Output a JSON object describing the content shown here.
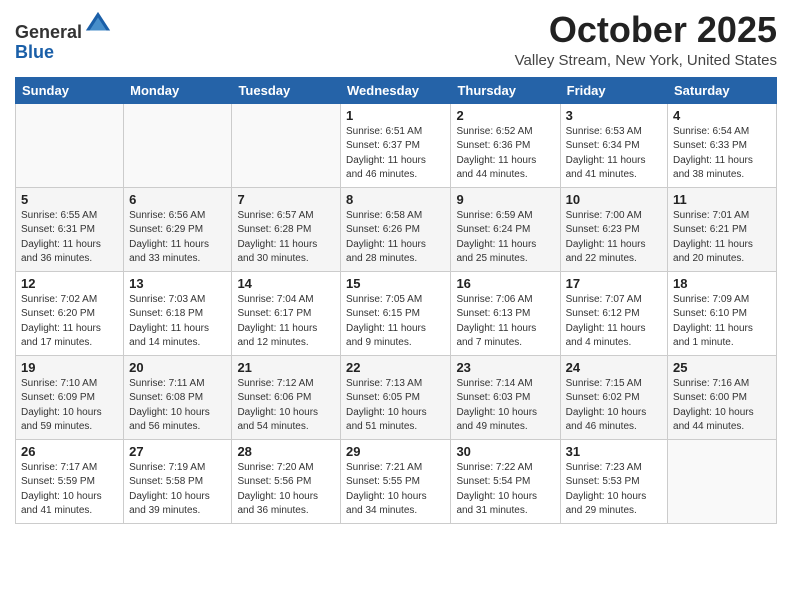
{
  "header": {
    "logo_general": "General",
    "logo_blue": "Blue",
    "month_title": "October 2025",
    "location": "Valley Stream, New York, United States"
  },
  "days_of_week": [
    "Sunday",
    "Monday",
    "Tuesday",
    "Wednesday",
    "Thursday",
    "Friday",
    "Saturday"
  ],
  "weeks": [
    [
      {
        "day": "",
        "info": ""
      },
      {
        "day": "",
        "info": ""
      },
      {
        "day": "",
        "info": ""
      },
      {
        "day": "1",
        "info": "Sunrise: 6:51 AM\nSunset: 6:37 PM\nDaylight: 11 hours\nand 46 minutes."
      },
      {
        "day": "2",
        "info": "Sunrise: 6:52 AM\nSunset: 6:36 PM\nDaylight: 11 hours\nand 44 minutes."
      },
      {
        "day": "3",
        "info": "Sunrise: 6:53 AM\nSunset: 6:34 PM\nDaylight: 11 hours\nand 41 minutes."
      },
      {
        "day": "4",
        "info": "Sunrise: 6:54 AM\nSunset: 6:33 PM\nDaylight: 11 hours\nand 38 minutes."
      }
    ],
    [
      {
        "day": "5",
        "info": "Sunrise: 6:55 AM\nSunset: 6:31 PM\nDaylight: 11 hours\nand 36 minutes."
      },
      {
        "day": "6",
        "info": "Sunrise: 6:56 AM\nSunset: 6:29 PM\nDaylight: 11 hours\nand 33 minutes."
      },
      {
        "day": "7",
        "info": "Sunrise: 6:57 AM\nSunset: 6:28 PM\nDaylight: 11 hours\nand 30 minutes."
      },
      {
        "day": "8",
        "info": "Sunrise: 6:58 AM\nSunset: 6:26 PM\nDaylight: 11 hours\nand 28 minutes."
      },
      {
        "day": "9",
        "info": "Sunrise: 6:59 AM\nSunset: 6:24 PM\nDaylight: 11 hours\nand 25 minutes."
      },
      {
        "day": "10",
        "info": "Sunrise: 7:00 AM\nSunset: 6:23 PM\nDaylight: 11 hours\nand 22 minutes."
      },
      {
        "day": "11",
        "info": "Sunrise: 7:01 AM\nSunset: 6:21 PM\nDaylight: 11 hours\nand 20 minutes."
      }
    ],
    [
      {
        "day": "12",
        "info": "Sunrise: 7:02 AM\nSunset: 6:20 PM\nDaylight: 11 hours\nand 17 minutes."
      },
      {
        "day": "13",
        "info": "Sunrise: 7:03 AM\nSunset: 6:18 PM\nDaylight: 11 hours\nand 14 minutes."
      },
      {
        "day": "14",
        "info": "Sunrise: 7:04 AM\nSunset: 6:17 PM\nDaylight: 11 hours\nand 12 minutes."
      },
      {
        "day": "15",
        "info": "Sunrise: 7:05 AM\nSunset: 6:15 PM\nDaylight: 11 hours\nand 9 minutes."
      },
      {
        "day": "16",
        "info": "Sunrise: 7:06 AM\nSunset: 6:13 PM\nDaylight: 11 hours\nand 7 minutes."
      },
      {
        "day": "17",
        "info": "Sunrise: 7:07 AM\nSunset: 6:12 PM\nDaylight: 11 hours\nand 4 minutes."
      },
      {
        "day": "18",
        "info": "Sunrise: 7:09 AM\nSunset: 6:10 PM\nDaylight: 11 hours\nand 1 minute."
      }
    ],
    [
      {
        "day": "19",
        "info": "Sunrise: 7:10 AM\nSunset: 6:09 PM\nDaylight: 10 hours\nand 59 minutes."
      },
      {
        "day": "20",
        "info": "Sunrise: 7:11 AM\nSunset: 6:08 PM\nDaylight: 10 hours\nand 56 minutes."
      },
      {
        "day": "21",
        "info": "Sunrise: 7:12 AM\nSunset: 6:06 PM\nDaylight: 10 hours\nand 54 minutes."
      },
      {
        "day": "22",
        "info": "Sunrise: 7:13 AM\nSunset: 6:05 PM\nDaylight: 10 hours\nand 51 minutes."
      },
      {
        "day": "23",
        "info": "Sunrise: 7:14 AM\nSunset: 6:03 PM\nDaylight: 10 hours\nand 49 minutes."
      },
      {
        "day": "24",
        "info": "Sunrise: 7:15 AM\nSunset: 6:02 PM\nDaylight: 10 hours\nand 46 minutes."
      },
      {
        "day": "25",
        "info": "Sunrise: 7:16 AM\nSunset: 6:00 PM\nDaylight: 10 hours\nand 44 minutes."
      }
    ],
    [
      {
        "day": "26",
        "info": "Sunrise: 7:17 AM\nSunset: 5:59 PM\nDaylight: 10 hours\nand 41 minutes."
      },
      {
        "day": "27",
        "info": "Sunrise: 7:19 AM\nSunset: 5:58 PM\nDaylight: 10 hours\nand 39 minutes."
      },
      {
        "day": "28",
        "info": "Sunrise: 7:20 AM\nSunset: 5:56 PM\nDaylight: 10 hours\nand 36 minutes."
      },
      {
        "day": "29",
        "info": "Sunrise: 7:21 AM\nSunset: 5:55 PM\nDaylight: 10 hours\nand 34 minutes."
      },
      {
        "day": "30",
        "info": "Sunrise: 7:22 AM\nSunset: 5:54 PM\nDaylight: 10 hours\nand 31 minutes."
      },
      {
        "day": "31",
        "info": "Sunrise: 7:23 AM\nSunset: 5:53 PM\nDaylight: 10 hours\nand 29 minutes."
      },
      {
        "day": "",
        "info": ""
      }
    ]
  ]
}
